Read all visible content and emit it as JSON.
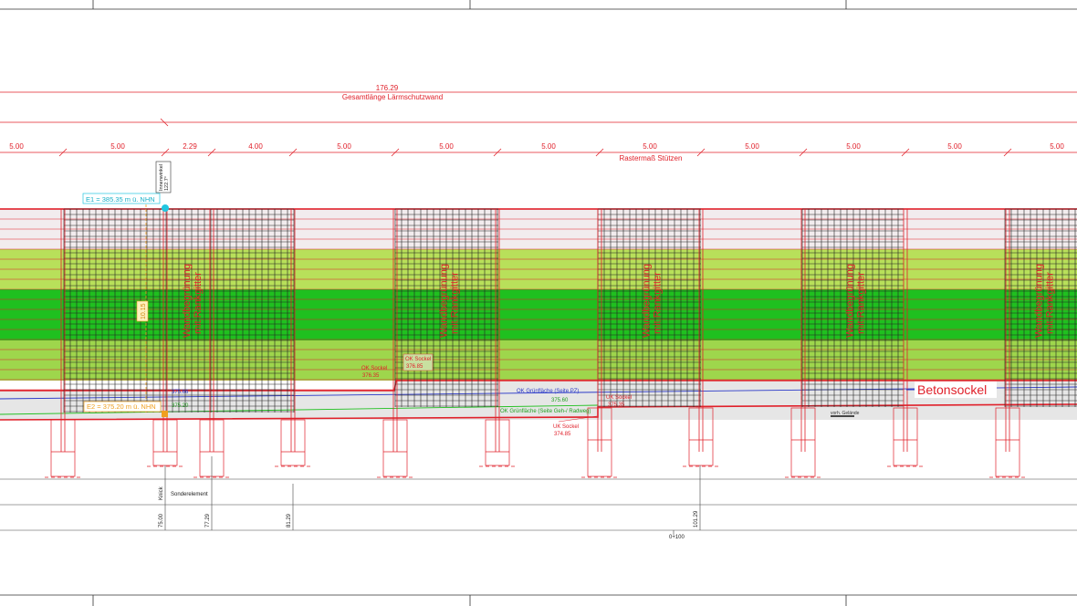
{
  "overall": {
    "length_value": "176.29",
    "length_label": "Gesamtlänge Lärmschutzwand"
  },
  "column_grid": {
    "label": "Rastermaß Stützen",
    "spacing_labels": [
      "5.00",
      "5.00",
      "2.29",
      "4.00",
      "5.00",
      "5.00",
      "5.00",
      "5.00",
      "5.00",
      "5.00",
      "5.00",
      "5.00"
    ]
  },
  "level_e1": "E1 = 385.35 m ü. NHN",
  "level_e2": "E2 = 375.20 m ü. NHN",
  "height_dim": "10.15",
  "corner_note": {
    "line1": "Innenwinkel",
    "line2": "122.7°"
  },
  "levels": {
    "small_a": "375.66",
    "small_b": "375.20",
    "ok_sockel_left_label": "OK Sockel",
    "ok_sockel_left_value": "376.35",
    "ok_sockel_mid_label": "OK Sockel",
    "ok_sockel_mid_value": "376.85",
    "uk_sockel_right_label": "UK Sockel",
    "uk_sockel_right_value": "375.35",
    "uk_sockel_low_label": "UK Sockel",
    "uk_sockel_low_value": "374.85",
    "gruen_pz_label": "OK Grünfläche (Seite PZ)",
    "gruen_value": "375.60",
    "gruen_geh_label": "OK Grünfläche (Seite Geh-/ Radweg)",
    "gelaende_label": "vorh. Gelände"
  },
  "panel_label": {
    "line1": "Wandbegrünung",
    "line2": "mit Rankgitter"
  },
  "betonsockel_label": "Betonsockel",
  "stations": {
    "knick_label": "Knick",
    "sonder_label": "Sonderelement",
    "values": [
      "75.00",
      "77.29",
      "81.29",
      "101.29"
    ],
    "chainage": "0+100"
  },
  "colors": {
    "red": "#e0202a",
    "light_green": "#b8e05a",
    "green": "#1fc01f",
    "blue": "#2a38c8",
    "cyan": "#22c6e0",
    "orange": "#f0a020",
    "concrete": "#e6e6e6"
  }
}
